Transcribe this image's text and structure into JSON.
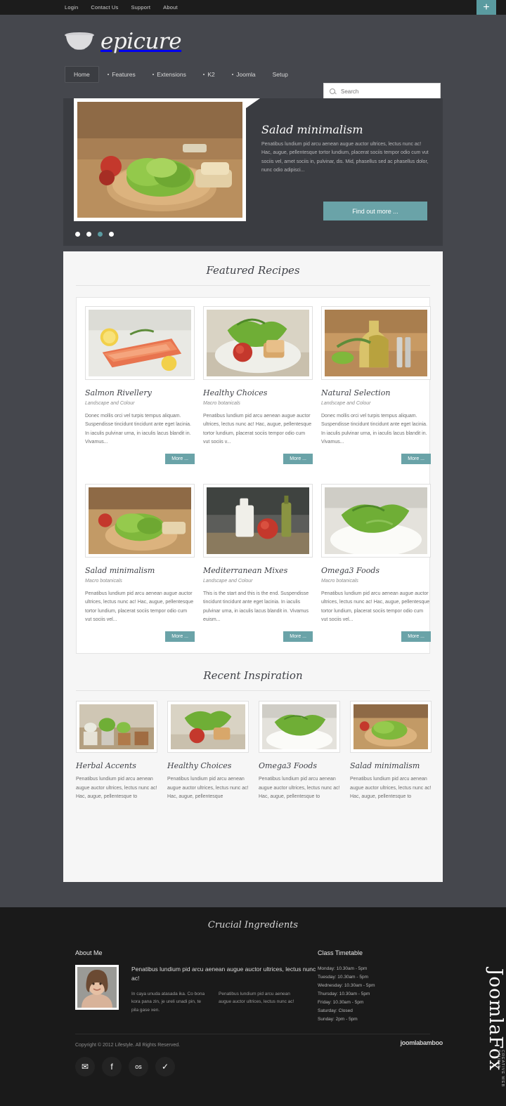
{
  "topbar": {
    "links": [
      "Login",
      "Contact Us",
      "Support",
      "About"
    ],
    "ribbon_icon": "plus-icon",
    "ribbon_label": "+"
  },
  "header": {
    "logo_text": "epicure",
    "logo_icon": "bowl-icon",
    "nav": [
      {
        "label": "Home",
        "active": true,
        "has_dropdown": false
      },
      {
        "label": "Features",
        "active": false,
        "has_dropdown": true
      },
      {
        "label": "Extensions",
        "active": false,
        "has_dropdown": true
      },
      {
        "label": "K2",
        "active": false,
        "has_dropdown": true
      },
      {
        "label": "Joomla",
        "active": false,
        "has_dropdown": true
      },
      {
        "label": "Setup",
        "active": false,
        "has_dropdown": false
      }
    ],
    "search": {
      "placeholder": "Search",
      "value": "",
      "icon": "search-icon"
    }
  },
  "slider": {
    "title": "Salad minimalism",
    "description": "Penatibus lundium pid arcu aenean augue auctor ultrices, lectus nunc ac! Hac, augue, pellentesque tortor lundium, placerat sociis tempor odio cum vut sociis vel, amet sociis in, pulvinar, dis. Mid, phasellus sed ac phasellus dolor, nunc odio adipisci...",
    "button_label": "Find out more ...",
    "dots_count": 4,
    "active_dot": 3,
    "image_alt": "salad-on-wooden-board"
  },
  "featured": {
    "heading": "Featured Recipes",
    "cards": [
      {
        "title": "Salmon Rivellery",
        "subtitle": "Landscape and Colour",
        "body": "Donec mollis orci vel turpis tempus aliquam. Suspendisse tincidunt tincidunt ante eget lacinia. In iaculis pulvinar urna, in iaculis lacus blandit in. Vivamus...",
        "more_label": "More ...",
        "image_alt": "salmon-fillet-with-lemon"
      },
      {
        "title": "Healthy Choices",
        "subtitle": "Macro botanicals",
        "body": "Penatibus lundium pid arcu aenean augue auctor ultrices, lectus nunc ac! Hac, augue, pellentesque tortor lundium, placerat sociis tempor odio cum vut sociis v...",
        "more_label": "More ...",
        "image_alt": "salad-with-tomato-and-bread"
      },
      {
        "title": "Natural Selection",
        "subtitle": "Landscape and Colour",
        "body": "Donec mollis orci vel turpis tempus aliquam. Suspendisse tincidunt tincidunt ante eget lacinia. In iaculis pulvinar urna, in iaculis lacus blandit in. Vivamus...",
        "more_label": "More ...",
        "image_alt": "olive-oil-bottle-with-herbs"
      },
      {
        "title": "Salad minimalism",
        "subtitle": "Macro botanicals",
        "body": "Penatibus lundium pid arcu aenean augue auctor ultrices, lectus nunc ac! Hac, augue, pellentesque tortor lundium, placerat sociis tempor odio cum vut sociis vel...",
        "more_label": "More ...",
        "image_alt": "lettuce-on-wooden-board"
      },
      {
        "title": "Mediterranean Mixes",
        "subtitle": "Landscape and Colour",
        "body": "This is the start and this is the end. Suspendisse tincidunt tincidunt ante eget lacinia. In iaculis pulvinar urna, in iaculis lacus blandit in. Vivamus euism...",
        "more_label": "More ...",
        "image_alt": "oil-bottle-and-tomato"
      },
      {
        "title": "Omega3 Foods",
        "subtitle": "Macro botanicals",
        "body": "Penatibus lundium pid arcu aenean augue auctor ultrices, lectus nunc ac! Hac, augue, pellentesque tortor lundium, placerat sociis tempor odio cum vut sociis vel...",
        "more_label": "More ...",
        "image_alt": "rocket-salad-on-plate"
      }
    ]
  },
  "recent": {
    "heading": "Recent Inspiration",
    "items": [
      {
        "title": "Herbal Accents",
        "body": "Penatibus lundium pid arcu aenean augue auctor ultrices, lectus nunc ac! Hac, augue, pellentesque to",
        "image_alt": "potted-herbs-on-shelf"
      },
      {
        "title": "Healthy Choices",
        "body": "Penatibus lundium pid arcu aenean augue auctor ultrices, lectus nunc ac! Hac, augue, pellentesque",
        "image_alt": "salad-with-tomato-and-bread"
      },
      {
        "title": "Omega3 Foods",
        "body": "Penatibus lundium pid arcu aenean augue auctor ultrices, lectus nunc ac! Hac, augue, pellentesque to",
        "image_alt": "rocket-salad-on-plate"
      },
      {
        "title": "Salad minimalism",
        "body": "Penatibus lundium pid arcu aenean augue auctor ultrices, lectus nunc ac! Hac, augue, pellentesque to",
        "image_alt": "lettuce-on-wooden-board"
      }
    ]
  },
  "footer": {
    "heading": "Crucial Ingredients",
    "about": {
      "title": "About Me",
      "avatar_alt": "portrait-of-woman",
      "lead": "Penatibus lundium pid arcu aenean augue auctor ultrices, lectus nunc ac!",
      "col1": "In caya unuda atasada ika. Co bona kora pana zin, je ureli unadi pin, te pila gase xen.",
      "col2": "Penatibus lundium pid arcu aenean augue auctor ultrices, lectus nunc ac!"
    },
    "timetable": {
      "title": "Class Timetable",
      "rows": [
        "Monday: 10.30am - 5pm",
        "Tuesday: 10.30am - 5pm",
        "Wednesday: 10.30am - 5pm",
        "Thursday: 10.30am - 5pm",
        "Friday: 10.30am - 5pm",
        "Saturday: Closed",
        "Sunday: 2pm - 5pm"
      ]
    },
    "copyright": "Copyright © 2012 Lifestyle. All Rights Reserved.",
    "socials": [
      {
        "name": "twitter-icon",
        "glyph": "✉"
      },
      {
        "name": "facebook-icon",
        "glyph": "f"
      },
      {
        "name": "lastfm-icon",
        "glyph": "os"
      },
      {
        "name": "vimeo-icon",
        "glyph": "✓"
      }
    ],
    "joomlabamboo": "joomlabamboo",
    "fox_brand": "JoomlaFox",
    "fox_tagline": "CREATIVE WEB STUDIO"
  },
  "colors": {
    "accent": "#6aa3a8",
    "header_bg": "#45474d",
    "footer_bg": "#1a1a1a",
    "content_bg": "#f6f6f6"
  }
}
